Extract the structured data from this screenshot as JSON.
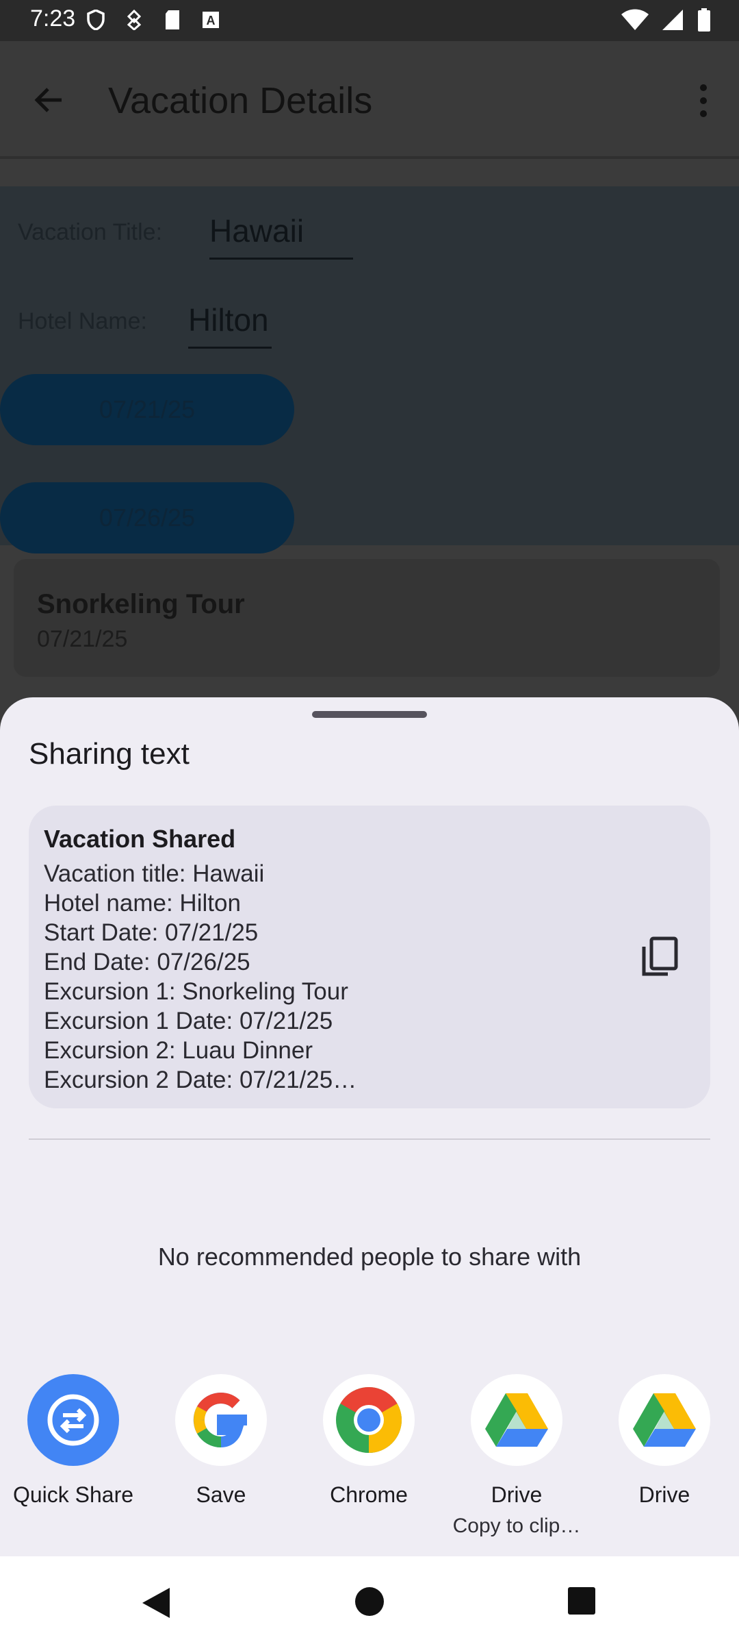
{
  "status_bar": {
    "time": "7:23",
    "left_icons": [
      "shield-icon",
      "usb-debug-icon",
      "sd-card-icon",
      "text-a-icon"
    ],
    "right_icons": [
      "wifi-icon",
      "signal-icon",
      "battery-icon"
    ]
  },
  "app_bar": {
    "title": "Vacation Details"
  },
  "form": {
    "vacation_title_label": "Vacation Title:",
    "vacation_title_value": "Hawaii",
    "hotel_name_label": "Hotel Name:",
    "hotel_name_value": "Hilton",
    "start_date": "07/21/25",
    "end_date": "07/26/25"
  },
  "excursion": {
    "name": "Snorkeling Tour",
    "date": "07/21/25"
  },
  "share_sheet": {
    "title": "Sharing text",
    "preview_title": "Vacation Shared",
    "preview_lines": [
      "Vacation title: Hawaii",
      "Hotel name: Hilton",
      "Start Date: 07/21/25",
      "End Date: 07/26/25",
      "Excursion 1: Snorkeling Tour",
      "Excursion 1 Date: 07/21/25",
      "Excursion 2: Luau Dinner",
      "Excursion 2 Date: 07/21/25…"
    ],
    "no_recommendations": "No recommended people to share with",
    "apps": [
      {
        "label": "Quick Share",
        "sub": ""
      },
      {
        "label": "Save",
        "sub": ""
      },
      {
        "label": "Chrome",
        "sub": ""
      },
      {
        "label": "Drive",
        "sub": "Copy to clip…"
      },
      {
        "label": "Drive",
        "sub": ""
      }
    ]
  },
  "colors": {
    "sheet_bg": "#efedf4",
    "preview_bg": "#e3e1ec",
    "quick_share_blue": "#4285f4"
  }
}
